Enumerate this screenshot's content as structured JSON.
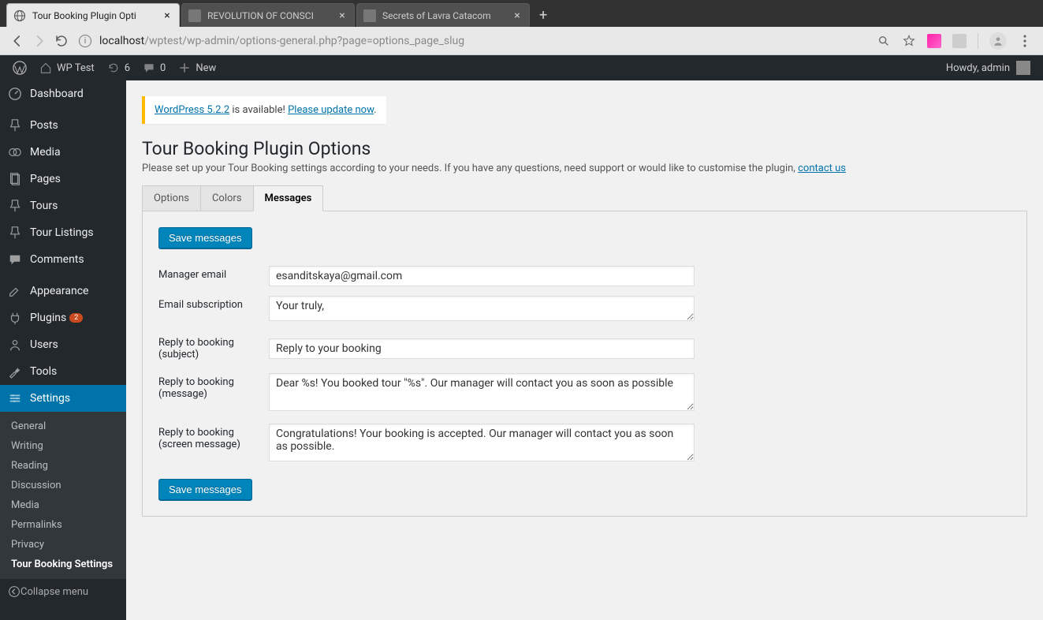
{
  "browser": {
    "tabs": [
      {
        "title": "Tour Booking Plugin Opti",
        "active": true
      },
      {
        "title": "REVOLUTION OF CONSCI",
        "active": false
      },
      {
        "title": "Secrets of Lavra Catacom",
        "active": false
      }
    ],
    "url_host": "localhost",
    "url_path": "/wptest/wp-admin/options-general.php?page=options_page_slug"
  },
  "adminbar": {
    "site_name": "WP Test",
    "updates": "6",
    "comments": "0",
    "new_label": "New",
    "howdy": "Howdy, admin"
  },
  "sidebar": {
    "items": [
      {
        "icon": "dashboard",
        "label": "Dashboard"
      },
      {
        "icon": "pin",
        "label": "Posts",
        "gap": true
      },
      {
        "icon": "media",
        "label": "Media"
      },
      {
        "icon": "page",
        "label": "Pages"
      },
      {
        "icon": "pin",
        "label": "Tours"
      },
      {
        "icon": "pin",
        "label": "Tour Listings"
      },
      {
        "icon": "comment",
        "label": "Comments"
      },
      {
        "icon": "appearance",
        "label": "Appearance",
        "gap": true
      },
      {
        "icon": "plugin",
        "label": "Plugins",
        "badge": "2"
      },
      {
        "icon": "users",
        "label": "Users"
      },
      {
        "icon": "tools",
        "label": "Tools"
      },
      {
        "icon": "settings",
        "label": "Settings",
        "current": true
      }
    ],
    "submenu": [
      {
        "label": "General"
      },
      {
        "label": "Writing"
      },
      {
        "label": "Reading"
      },
      {
        "label": "Discussion"
      },
      {
        "label": "Media"
      },
      {
        "label": "Permalinks"
      },
      {
        "label": "Privacy"
      },
      {
        "label": "Tour Booking Settings",
        "current": true
      }
    ],
    "collapse": "Collapse menu"
  },
  "notice": {
    "link1": "WordPress 5.2.2",
    "mid": " is available! ",
    "link2": "Please update now"
  },
  "page": {
    "title": "Tour Booking Plugin Options",
    "desc_pre": "Please set up your Tour Booking settings according to your needs. If you have any questions, need support or would like to customise the plugin, ",
    "desc_link": "contact us"
  },
  "tabs": [
    {
      "label": "Options"
    },
    {
      "label": "Colors"
    },
    {
      "label": "Messages",
      "active": true
    }
  ],
  "form": {
    "save_label": "Save messages",
    "fields": {
      "manager_email": {
        "label": "Manager email",
        "value": "esanditskaya@gmail.com"
      },
      "email_sub": {
        "label": "Email subscription",
        "value": "Your truly,"
      },
      "reply_subject": {
        "label": "Reply to booking (subject)",
        "value": "Reply to your booking"
      },
      "reply_message": {
        "label": "Reply to booking (message)",
        "value": "Dear %s! You booked tour \"%s\". Our manager will contact you as soon as possible"
      },
      "reply_screen": {
        "label": "Reply to booking (screen message)",
        "value": "Congratulations! Your booking is accepted. Our manager will contact you as soon as possible."
      }
    }
  }
}
